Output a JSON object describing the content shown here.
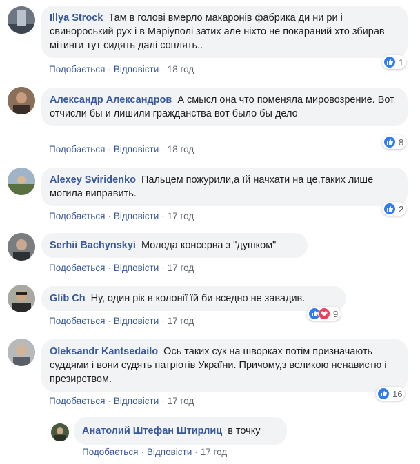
{
  "comments": [
    {
      "author": "Illya Strock",
      "text": "Там в голові вмерло макаронів фабрика ди ни ри і свинороський рух і в Маріуполі затих але ніхто не покараний хто збирав мітинги тут сидять далі соплять..",
      "like": "Подобається",
      "reply": "Відповісти",
      "time": "18 год",
      "reaction_count": "1",
      "reactions": [
        "like-icon"
      ]
    },
    {
      "author": "Александр Александров",
      "text": "А смысл она что поменяла мировозрение. Вот отчисли бы и лишили гражданства вот было бы дело",
      "like": "Подобається",
      "reply": "Відповісти",
      "time": "18 год",
      "reaction_count": "8",
      "reactions": [
        "like-icon"
      ]
    },
    {
      "author": "Alexey Sviridenko",
      "text": "Пальцем пожурили,а їй начхати на це,таких лише могила виправить.",
      "like": "Подобається",
      "reply": "Відповісти",
      "time": "17 год",
      "reaction_count": "2",
      "reactions": [
        "like-icon"
      ]
    },
    {
      "author": "Serhii Bachynskyi",
      "text": "Молода консерва з \"душком\"",
      "like": "Подобається",
      "reply": "Відповісти",
      "time": "17 год"
    },
    {
      "author": "Glib Ch",
      "text": "Ну, один рік в колонії їй би вседно не завадив.",
      "like": "Подобається",
      "reply": "Відповісти",
      "time": "17 год",
      "reaction_count": "9",
      "reactions": [
        "like-icon",
        "love-icon"
      ]
    },
    {
      "author": "Oleksandr Kantsedailo",
      "text": "Ось таких сук на шворках потім призначають суддями і вони судять патріотів України. Причому,з великою ненавистю і презирством.",
      "like": "Подобається",
      "reply": "Відповісти",
      "time": "17 год",
      "reaction_count": "16",
      "reactions": [
        "like-icon"
      ]
    },
    {
      "author": "Анатолий Штефан Штирлиц",
      "text": "в точку",
      "like": "Подобається",
      "reply": "Відповісти",
      "time": "17 год"
    }
  ],
  "colors": {
    "author": "#385898",
    "bubble": "#f2f3f5",
    "like_reaction": "#2e7bf6",
    "love_reaction": "#f33e58"
  }
}
